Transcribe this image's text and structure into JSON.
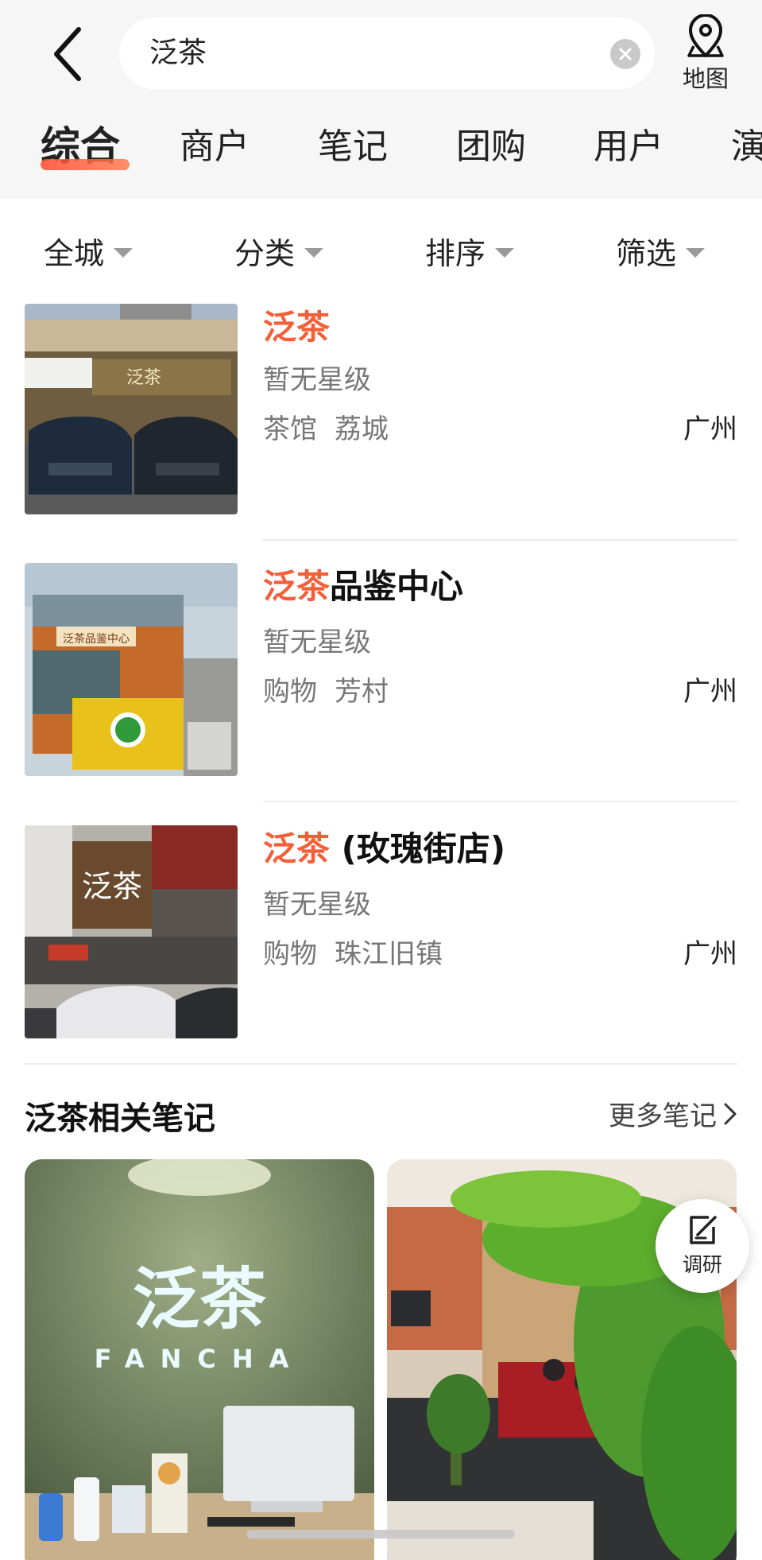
{
  "search": {
    "query": "泛茶",
    "map_label": "地图"
  },
  "tabs": [
    "综合",
    "商户",
    "笔记",
    "团购",
    "用户",
    "演"
  ],
  "filters": [
    "全城",
    "分类",
    "排序",
    "筛选"
  ],
  "shops": [
    {
      "title_highlight": "泛茶",
      "title_rest": "",
      "rating": "暂无星级",
      "category": "茶馆",
      "area": "荔城",
      "city": "广州",
      "photo_sign": "泛茶"
    },
    {
      "title_highlight": "泛茶",
      "title_rest": "品鉴中心",
      "rating": "暂无星级",
      "category": "购物",
      "area": "芳村",
      "city": "广州",
      "photo_sign": "泛茶品鉴中心"
    },
    {
      "title_highlight": "泛茶",
      "title_rest": " (玫瑰街店)",
      "rating": "暂无星级",
      "category": "购物",
      "area": "珠江旧镇",
      "city": "广州",
      "photo_sign": "泛茶"
    }
  ],
  "notes": {
    "title": "泛茶相关笔记",
    "more": "更多笔记",
    "cards": [
      {
        "sign": "泛茶",
        "sign_en": "FANCHA"
      },
      {
        "sign": ""
      }
    ]
  },
  "survey": {
    "label": "调研"
  },
  "colors": {
    "accent": "#f2603a",
    "header_bg": "#f6f6f6"
  }
}
